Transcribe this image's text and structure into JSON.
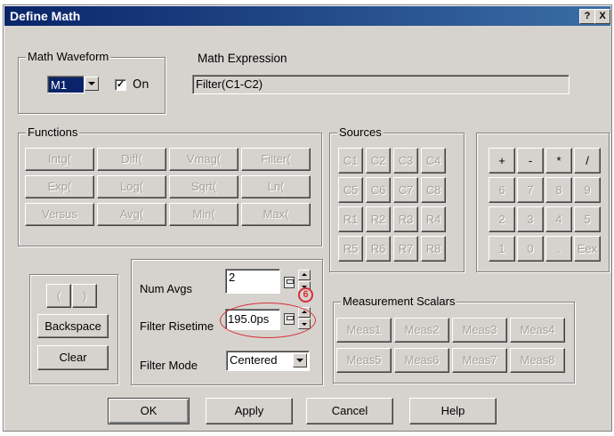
{
  "window": {
    "title": "Define Math",
    "help_label": "?",
    "close_label": "X"
  },
  "math_waveform": {
    "group_label": "Math Waveform",
    "selected": "M1",
    "on_label": "On",
    "on_checked": true,
    "check_mark": "✓"
  },
  "math_expression": {
    "label": "Math Expression",
    "value": "Filter(C1-C2)"
  },
  "functions": {
    "group_label": "Functions",
    "buttons": [
      "Intg(",
      "Diff(",
      "Vmag(",
      "Filter(",
      "Exp(",
      "Log(",
      "Sqrt(",
      "Ln(",
      "Versus",
      "Avg(",
      "Min(",
      "Max("
    ]
  },
  "sources": {
    "group_label": "Sources",
    "buttons": [
      "C1",
      "C2",
      "C3",
      "C4",
      "C5",
      "C6",
      "C7",
      "C8",
      "R1",
      "R2",
      "R3",
      "R4",
      "R5",
      "R6",
      "R7",
      "R8"
    ]
  },
  "keypad": {
    "buttons": [
      "+",
      "-",
      "*",
      "/",
      "6",
      "7",
      "8",
      "9",
      "2",
      "3",
      "4",
      "5",
      "1",
      "0",
      ".",
      "Eex"
    ]
  },
  "editing": {
    "open_paren": "(",
    "close_paren": ")",
    "backspace": "Backspace",
    "clear": "Clear"
  },
  "settings": {
    "num_avgs_label": "Num Avgs",
    "num_avgs_value": "2",
    "filter_risetime_label": "Filter Risetime",
    "filter_risetime_value": "195.0ps",
    "filter_mode_label": "Filter Mode",
    "filter_mode_value": "Centered",
    "annotation_number": "6"
  },
  "measurement_scalars": {
    "group_label": "Measurement Scalars",
    "buttons": [
      "Meas1",
      "Meas2",
      "Meas3",
      "Meas4",
      "Meas5",
      "Meas6",
      "Meas7",
      "Meas8"
    ]
  },
  "footer": {
    "ok": "OK",
    "apply": "Apply",
    "cancel": "Cancel",
    "help": "Help"
  },
  "colors": {
    "titlebar_start": "#0a246a",
    "titlebar_end": "#3a6ea5",
    "dialog_face": "#d6d3ce",
    "annotation": "#d9303a"
  }
}
